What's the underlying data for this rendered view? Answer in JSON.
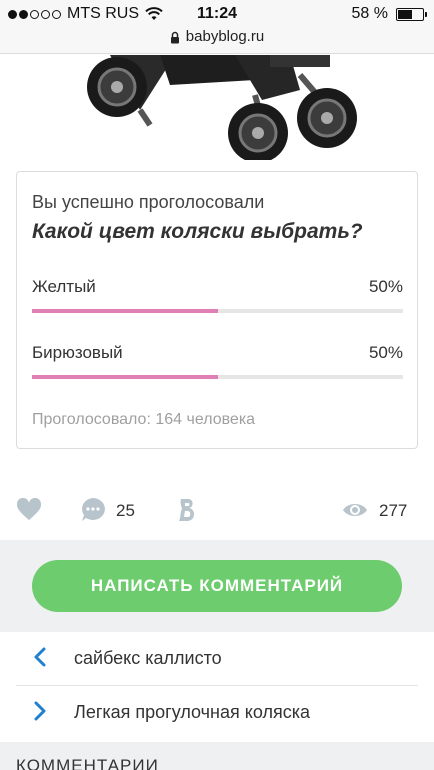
{
  "status_bar": {
    "carrier": "MTS RUS",
    "time": "11:24",
    "battery_text": "58 %",
    "battery_level": 0.58
  },
  "browser": {
    "url": "babyblog.ru"
  },
  "poll": {
    "status": "Вы успешно проголосовали",
    "question": "Какой цвет коляски выбрать?",
    "options": [
      {
        "label": "Желтый",
        "percent_text": "50%",
        "fraction": 0.5
      },
      {
        "label": "Бирюзовый",
        "percent_text": "50%",
        "fraction": 0.5
      }
    ],
    "total": "Проголосовало: 164 человека",
    "bar_color": "#e07fb4"
  },
  "stats": {
    "comments_count": "25",
    "views_count": "277"
  },
  "comment_button": {
    "label": "НАПИСАТЬ КОММЕНТАРИЙ",
    "color": "#6dcc6d"
  },
  "nav": {
    "prev_label": "сайбекс каллисто",
    "next_label": "Легкая прогулочная коляска",
    "arrow_color": "#1f7fd1"
  },
  "comments_section": {
    "title": "КОММЕНТАРИИ"
  },
  "icons": {
    "signal": "signal-dots-icon",
    "wifi": "wifi-icon",
    "battery": "battery-icon",
    "lock": "lock-icon",
    "like": "heart-icon",
    "comments": "speech-bubble-icon",
    "share": "babyblog-b-icon",
    "views": "eye-icon",
    "prev": "chevron-left-icon",
    "next": "chevron-right-icon"
  }
}
